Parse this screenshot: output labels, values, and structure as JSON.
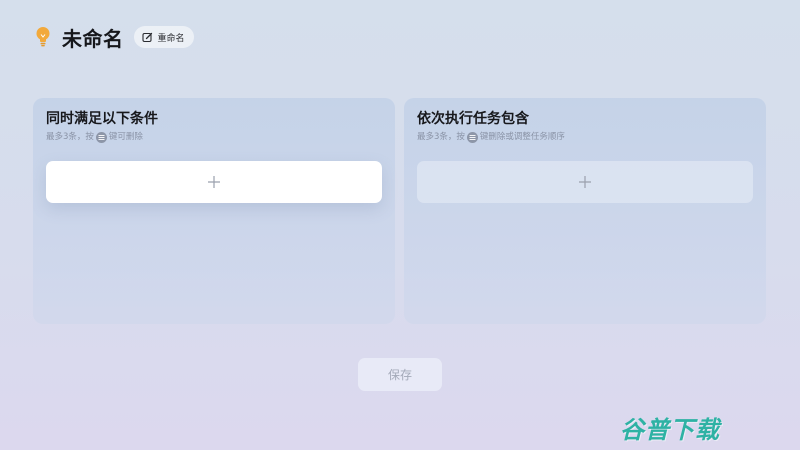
{
  "header": {
    "icon": "lightbulb-icon",
    "title": "未命名",
    "rename_label": "重命名"
  },
  "conditions_panel": {
    "title": "同时满足以下条件",
    "hint_prefix": "最多3条，按",
    "hint_suffix": "键可删除",
    "add_icon": "plus-icon"
  },
  "tasks_panel": {
    "title": "依次执行任务包含",
    "hint_prefix": "最多3条，按",
    "hint_suffix": "键删除或调整任务顺序",
    "add_icon": "plus-icon"
  },
  "save_label": "保存",
  "watermark": "谷普下载",
  "colors": {
    "accent_bulb": "#f2a93b",
    "watermark": "#2eb2a4",
    "focused_slot": "#ffffff"
  }
}
